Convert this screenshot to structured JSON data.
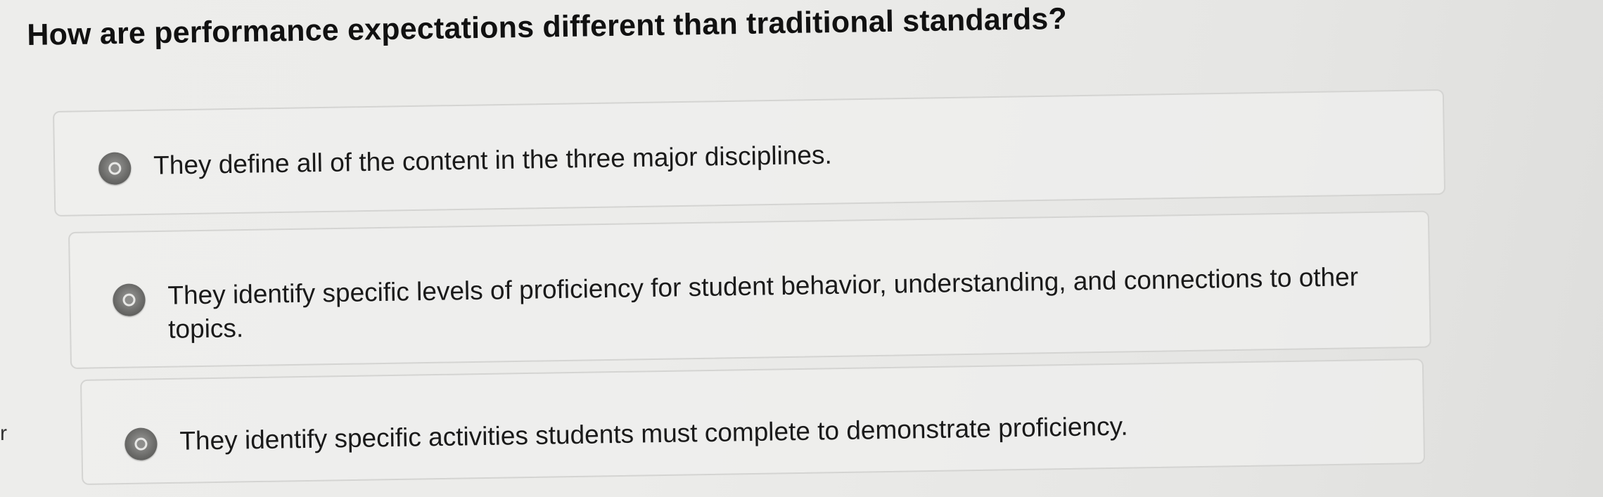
{
  "question": {
    "text": "How are performance expectations different than traditional standards?"
  },
  "options": [
    {
      "label": "They define all of the content in the three major disciplines."
    },
    {
      "label": "They identify specific levels of proficiency for student behavior, understanding, and connections to other topics."
    },
    {
      "label": "They identify specific activities students must complete to demonstrate proficiency."
    }
  ],
  "edge_text": "r"
}
